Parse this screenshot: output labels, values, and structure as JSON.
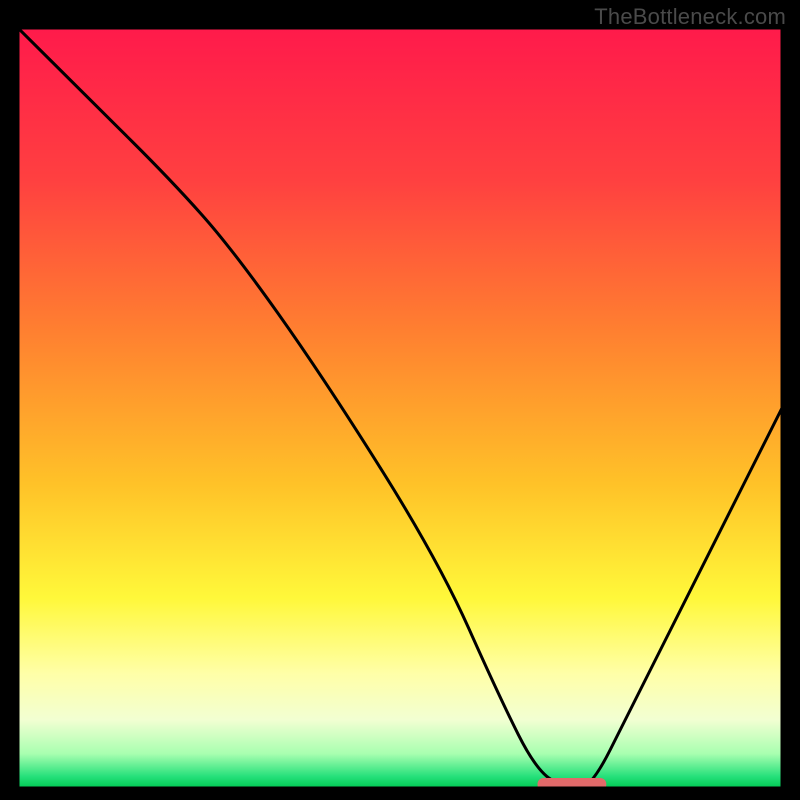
{
  "watermark": "TheBottleneck.com",
  "chart_data": {
    "type": "line",
    "title": "",
    "xlabel": "",
    "ylabel": "",
    "xlim": [
      0,
      100
    ],
    "ylim": [
      0,
      100
    ],
    "x": [
      0,
      10,
      20,
      28,
      40,
      55,
      63,
      68,
      72,
      75,
      80,
      90,
      100
    ],
    "values": [
      100,
      90,
      80,
      71,
      54,
      30,
      12,
      2,
      0,
      0,
      10,
      30,
      50
    ],
    "gradient_stops": [
      {
        "offset": 0.0,
        "color": "#ff1a4b"
      },
      {
        "offset": 0.2,
        "color": "#ff4040"
      },
      {
        "offset": 0.4,
        "color": "#ff8030"
      },
      {
        "offset": 0.6,
        "color": "#ffc228"
      },
      {
        "offset": 0.75,
        "color": "#fff83a"
      },
      {
        "offset": 0.85,
        "color": "#ffffa8"
      },
      {
        "offset": 0.91,
        "color": "#f2ffd2"
      },
      {
        "offset": 0.955,
        "color": "#a8ffb0"
      },
      {
        "offset": 0.985,
        "color": "#25e07a"
      },
      {
        "offset": 1.0,
        "color": "#00c853"
      }
    ],
    "marker": {
      "x_start": 68,
      "x_end": 77,
      "y": 0,
      "color": "#e16a6a"
    },
    "grid": false,
    "legend": null
  }
}
